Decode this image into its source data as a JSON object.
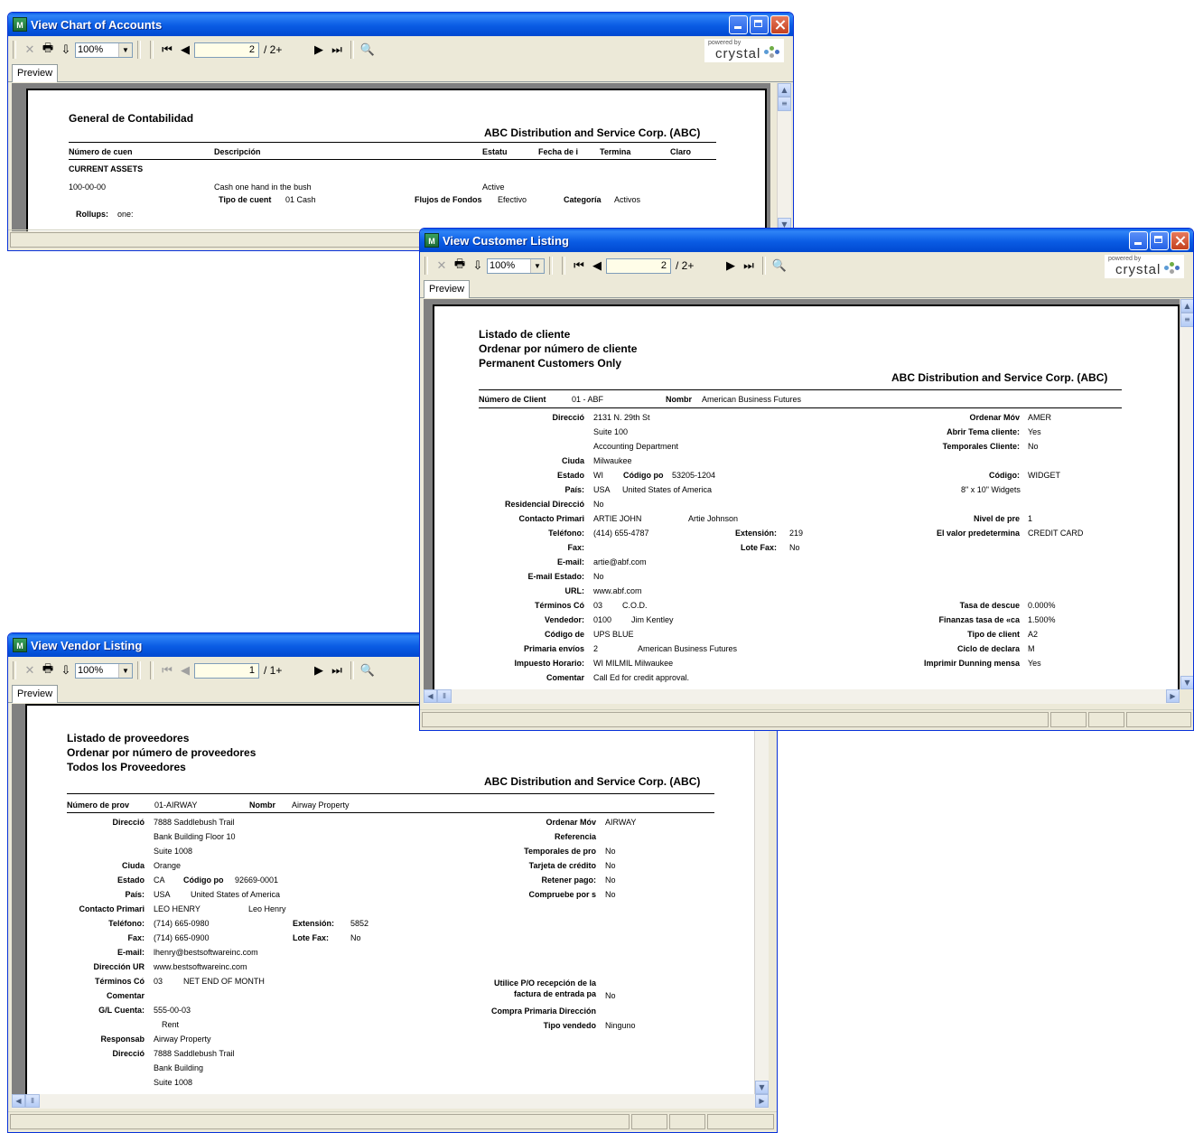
{
  "common": {
    "zoom": "100%",
    "tab_label": "Preview",
    "powered_by": "powered by",
    "crystal": "crystal",
    "company": "ABC Distribution and Service Corp. (ABC)"
  },
  "w_accounts": {
    "title": "View Chart of Accounts",
    "page": "2",
    "page_count": "/ 2+",
    "report_title": "General de Contabilidad",
    "col_numero": "Número de cuen",
    "col_desc": "Descripción",
    "col_estatu": "Estatu",
    "col_fecha": "Fecha de i",
    "col_termina": "Termina",
    "col_claro": "Claro",
    "section": "CURRENT ASSETS",
    "acct_num": "100-00-00",
    "acct_desc": "Cash one hand in the bush",
    "acct_status": "Active",
    "tipo_label": "Tipo de cuent",
    "tipo_value": "01 Cash",
    "flujos_label": "Flujos de Fondos",
    "flujos_value": "Efectivo",
    "categoria_label": "Categoría",
    "categoria_value": "Activos",
    "rollups_label": "Rollups:",
    "rollups_value": "one:"
  },
  "w_customer": {
    "title": "View Customer Listing",
    "page": "2",
    "page_count": "/ 2+",
    "report_title1": "Listado de cliente",
    "report_title2": "Ordenar por número de cliente",
    "report_title3": "Permanent Customers Only",
    "num_label": "Número de Client",
    "num_value": "01 - ABF",
    "nombre_label": "Nombr",
    "nombre_value": "American Business Futures",
    "direccion_label": "Direcció",
    "addr1": "2131 N. 29th St",
    "addr2": "Suite 100",
    "addr3": "Accounting Department",
    "ciudad_label": "Ciuda",
    "ciudad_value": "Milwaukee",
    "estado_label": "Estado",
    "estado_value": "WI",
    "codigo_postal_label": "Código po",
    "codigo_postal_value": "53205-1204",
    "pais_label": "País:",
    "pais_value": "USA",
    "pais_name": "United States of America",
    "residencial_label": "Residencial Direcció",
    "residencial_value": "No",
    "contacto_label": "Contacto Primari",
    "contacto_value": "ARTIE JOHN",
    "contacto_name": "Artie Johnson",
    "telefono_label": "Teléfono:",
    "telefono_value": "(414) 655-4787",
    "extension_label": "Extensión:",
    "extension_value": "219",
    "fax_label": "Fax:",
    "lote_fax_label": "Lote Fax:",
    "lote_fax_value": "No",
    "email_label": "E-mail:",
    "email_value": "artie@abf.com",
    "email_estado_label": "E-mail Estado:",
    "email_estado_value": "No",
    "url_label": "URL:",
    "url_value": "www.abf.com",
    "terminos_label": "Términos Có",
    "terminos_code": "03",
    "terminos_value": "C.O.D.",
    "vendedor_label": "Vendedor:",
    "vendedor_code": "0100",
    "vendedor_name": "Jim Kentley",
    "codigo_de_label": "Código de",
    "codigo_de_value": "UPS BLUE",
    "primaria_label": "Primaria envíos",
    "primaria_code": "2",
    "primaria_name": "American Business Futures",
    "impuesto_label": "Impuesto Horario:",
    "impuesto_value": "WI MILMIL Milwaukee",
    "comentar_label": "Comentar",
    "comentar_value": "Call Ed for credit approval.",
    "ordenar_label": "Ordenar Móv",
    "ordenar_value": "AMER",
    "abrir_label": "Abrir Tema cliente:",
    "abrir_value": "Yes",
    "temporales_label": "Temporales Cliente:",
    "temporales_value": "No",
    "codigo_label": "Código:",
    "codigo_value": "WIDGET",
    "widgets": "8\" x 10\" Widgets",
    "nivel_label": "Nivel de pre",
    "nivel_value": "1",
    "valor_label": "El valor predetermina",
    "valor_value": "CREDIT CARD",
    "tasa_label": "Tasa de descue",
    "tasa_value": "0.000%",
    "finanzas_label": "Finanzas tasa de «ca",
    "finanzas_value": "1.500%",
    "tipo_label": "Tipo de client",
    "tipo_value": "A2",
    "ciclo_label": "Ciclo de declara",
    "ciclo_value": "M",
    "imprimir_label": "Imprimir Dunning mensa",
    "imprimir_value": "Yes"
  },
  "w_vendor": {
    "title": "View Vendor Listing",
    "page": "1",
    "page_count": "/ 1+",
    "report_title1": "Listado de proveedores",
    "report_title2": "Ordenar por número de proveedores",
    "report_title3": "Todos los Proveedores",
    "num_label": "Número de prov",
    "num_value": "01-AIRWAY",
    "nombre_label": "Nombr",
    "nombre_value": "Airway Property",
    "direccion_label": "Direcció",
    "addr1": "7888 Saddlebush Trail",
    "addr2": "Bank Building Floor 10",
    "addr3": "Suite 1008",
    "ciudad_label": "Ciuda",
    "ciudad_value": "Orange",
    "estado_label": "Estado",
    "estado_value": "CA",
    "codigo_postal_label": "Código po",
    "codigo_postal_value": "92669-0001",
    "pais_label": "País:",
    "pais_value": "USA",
    "pais_name": "United States of America",
    "contacto_label": "Contacto Primari",
    "contacto_value": "LEO HENRY",
    "contacto_name": "Leo Henry",
    "telefono_label": "Teléfono:",
    "telefono_value": "(714) 665-0980",
    "extension_label": "Extensión:",
    "extension_value": "5852",
    "fax_label": "Fax:",
    "fax_value": "(714) 665-0900",
    "lote_fax_label": "Lote Fax:",
    "lote_fax_value": "No",
    "email_label": "E-mail:",
    "email_value": "lhenry@bestsoftwareinc.com",
    "dir_url_label": "Dirección UR",
    "dir_url_value": "www.bestsoftwareinc.com",
    "terminos_label": "Términos Có",
    "terminos_code": "03",
    "terminos_value": "NET END OF MONTH",
    "comentar_label": "Comentar",
    "gl_label": "G/L Cuenta:",
    "gl_value": "555-00-03",
    "gl_name": "Rent",
    "responsab_label": "Responsab",
    "responsab_value": "Airway Property",
    "direccion2_label": "Direcció",
    "r_addr1": "7888 Saddlebush Trail",
    "r_addr2": "Bank Building",
    "r_addr3": "Suite 1008",
    "ordenar_label": "Ordenar Móv",
    "ordenar_value": "AIRWAY",
    "referencia_label": "Referencia",
    "temporales_label": "Temporales de pro",
    "temporales_value": "No",
    "tarjeta_label": "Tarjeta de crédito",
    "tarjeta_value": "No",
    "retener_label": "Retener pago:",
    "retener_value": "No",
    "compruebe_label": "Compruebe por s",
    "compruebe_value": "No",
    "utilice_label1": "Utilice P/O recepción de la",
    "utilice_label2": "factura de entrada pa",
    "utilice_value": "No",
    "compra_label": "Compra Primaria Dirección",
    "tipo_vend_label": "Tipo vendedo",
    "tipo_vend_value": "Ninguno"
  }
}
